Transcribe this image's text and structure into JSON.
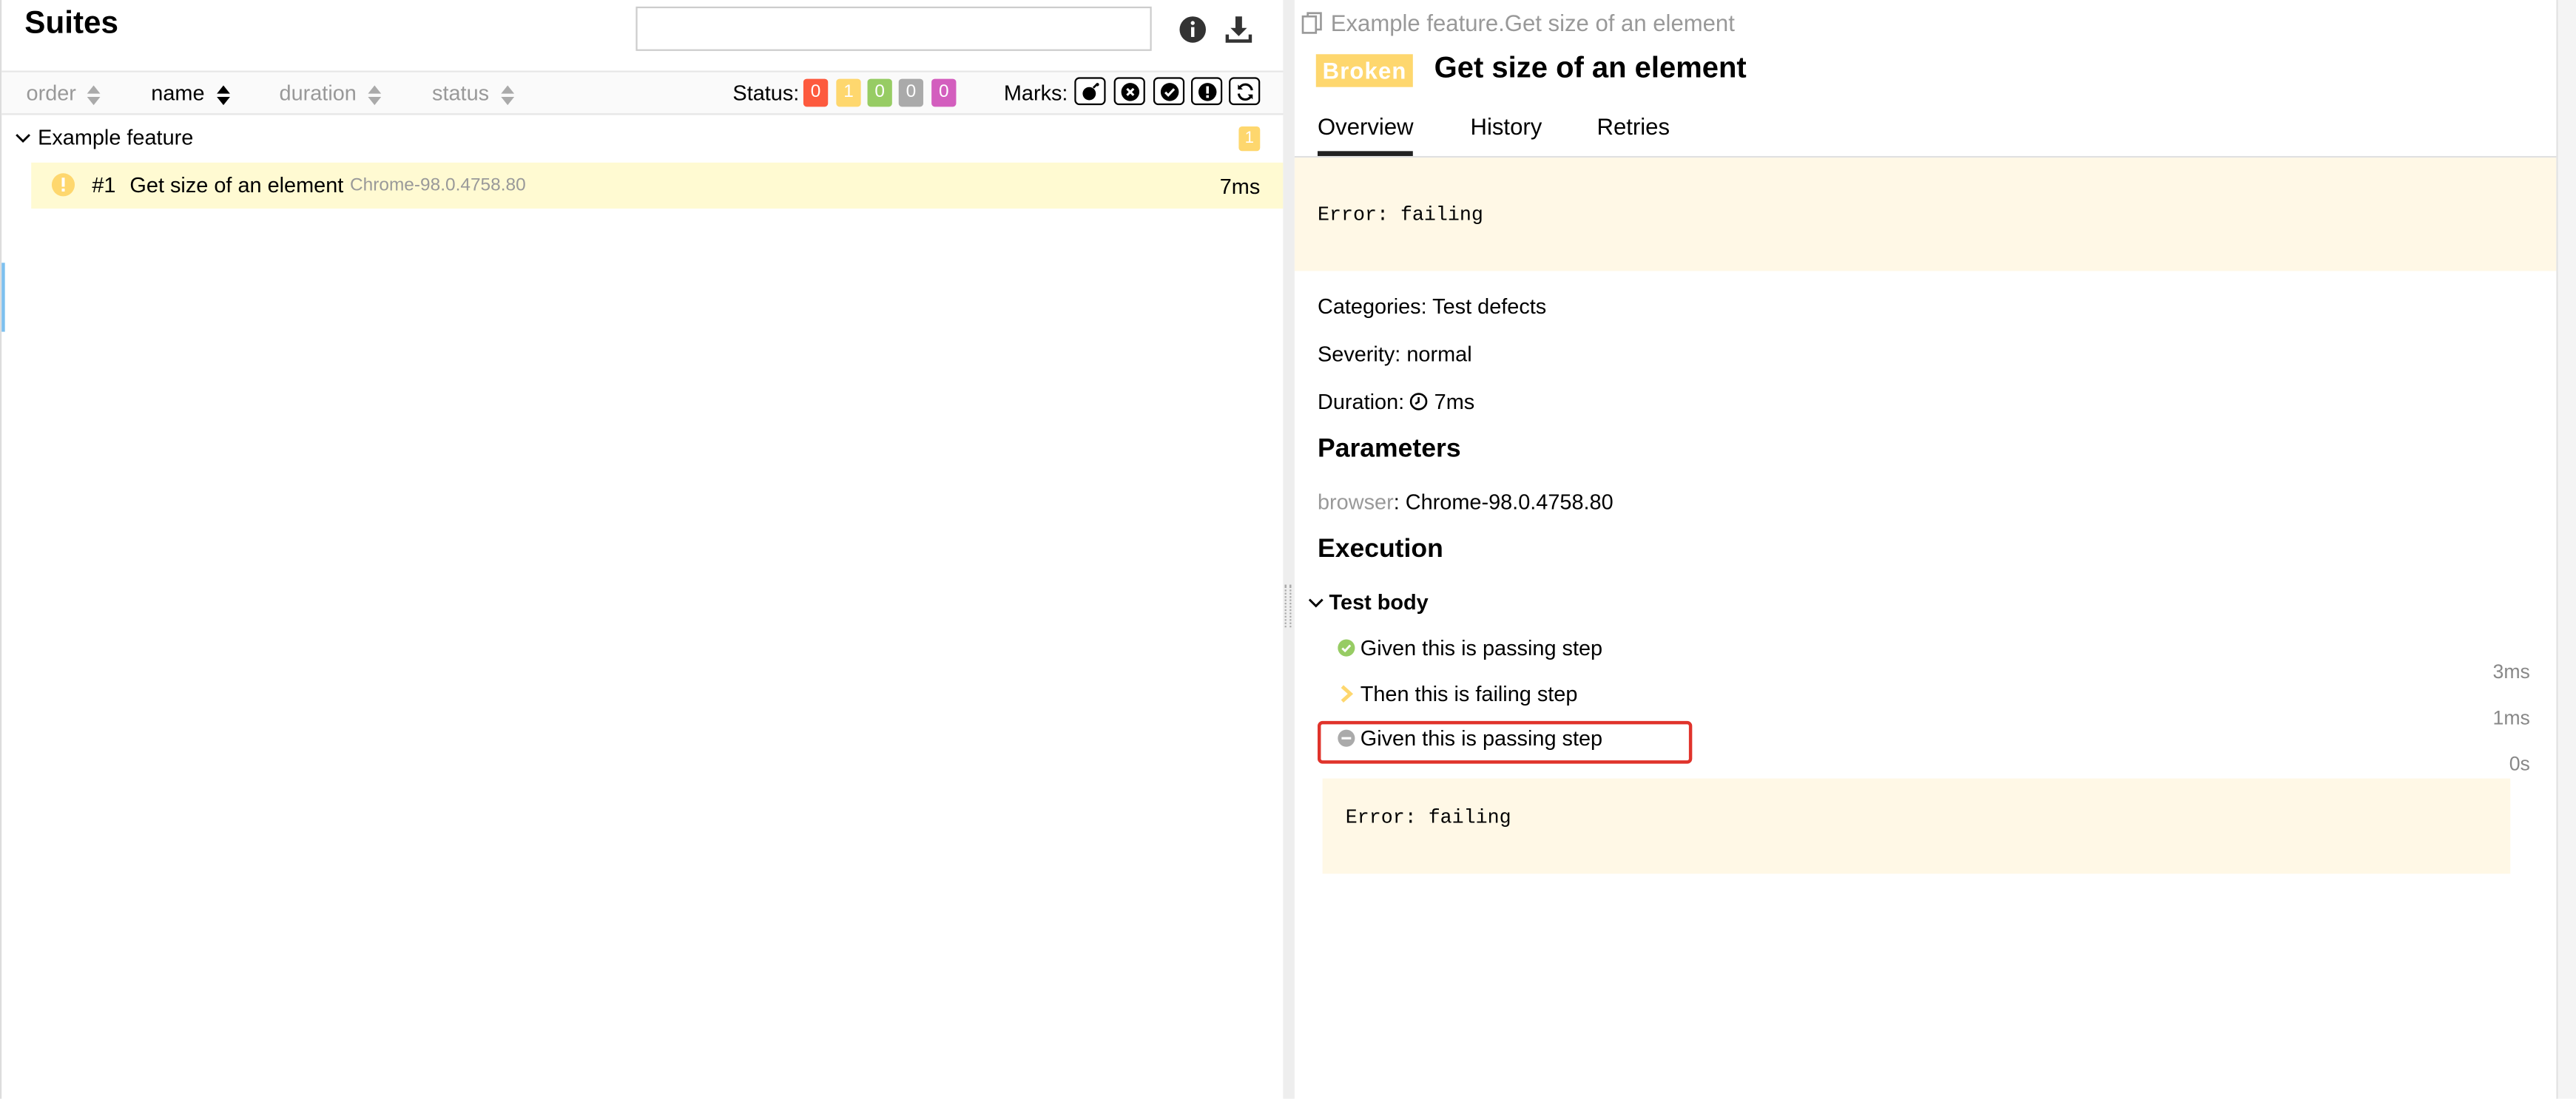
{
  "suites": {
    "title": "Suites",
    "search": {
      "placeholder": "",
      "value": ""
    },
    "sort_columns": [
      {
        "label": "order"
      },
      {
        "label": "name"
      },
      {
        "label": "duration"
      },
      {
        "label": "status"
      }
    ],
    "status_label": "Status:",
    "status_counts": [
      {
        "value": "0",
        "color": "#fd5a3e"
      },
      {
        "value": "1",
        "color": "#fed76e"
      },
      {
        "value": "0",
        "color": "#97cc64"
      },
      {
        "value": "0",
        "color": "#aaaaaa"
      },
      {
        "value": "0",
        "color": "#d35ebe"
      }
    ],
    "marks_label": "Marks:",
    "mark_icons": [
      "flaky-bomb-icon",
      "new-failed-icon",
      "new-passed-icon",
      "new-broken-icon",
      "retries-icon"
    ],
    "group": {
      "name": "Example feature",
      "count": "1"
    },
    "tests": [
      {
        "number": "#1",
        "name": "Get size of an element",
        "parameter": "Chrome-98.0.4758.80",
        "duration": "7ms",
        "status_icon": "warning-icon"
      }
    ]
  },
  "detail": {
    "breadcrumb": "Example feature.Get size of an element",
    "status": "Broken",
    "status_color": "#fed76e",
    "title": "Get size of an element",
    "tabs": [
      {
        "label": "Overview"
      },
      {
        "label": "History"
      },
      {
        "label": "Retries"
      }
    ],
    "error": "Error: failing",
    "categories": {
      "label": "Categories:",
      "value": "Test defects"
    },
    "severity": {
      "label": "Severity:",
      "value": "normal"
    },
    "duration": {
      "label": "Duration:",
      "value": "7ms"
    },
    "parameters_heading": "Parameters",
    "parameter": {
      "key": "browser",
      "value": "Chrome-98.0.4758.80"
    },
    "execution_heading": "Execution",
    "test_body": "Test body",
    "steps": [
      {
        "name": "Given this is passing step",
        "duration": "3ms",
        "status": "passed"
      },
      {
        "name": "Then this is failing step",
        "duration": "1ms",
        "status": "broken"
      },
      {
        "name": "Given this is passing step",
        "duration": "0s",
        "status": "skipped"
      }
    ],
    "step_error": "Error: failing"
  }
}
